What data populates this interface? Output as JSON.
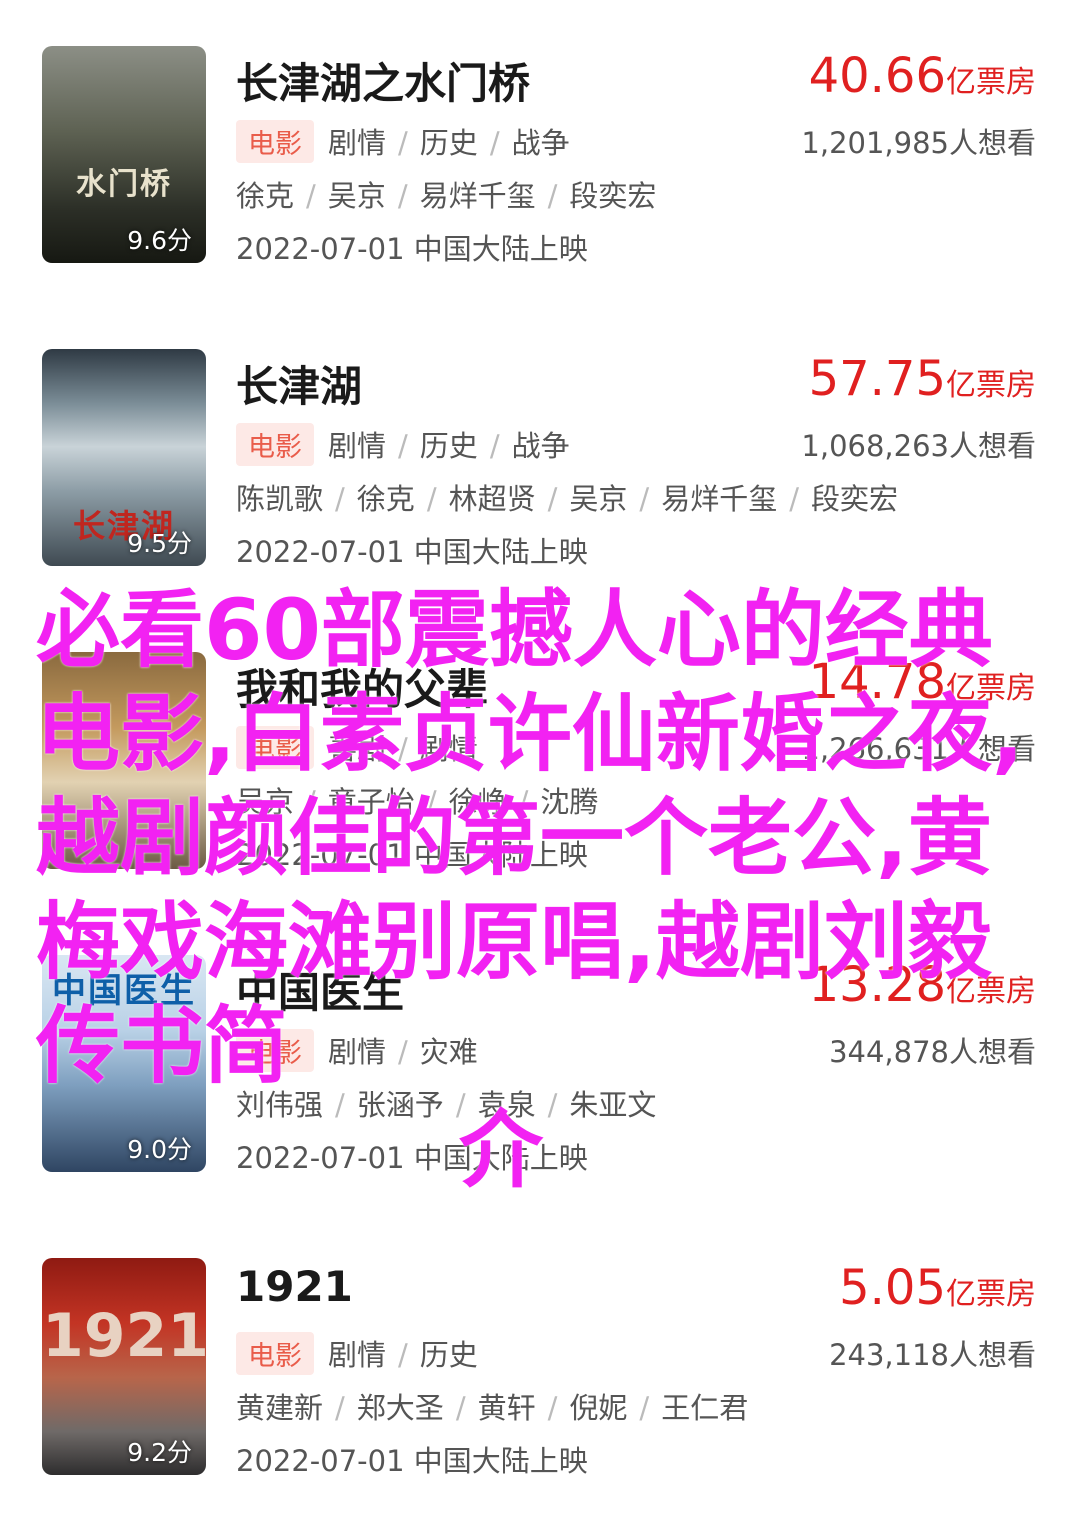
{
  "movies": [
    {
      "title": "长津湖之水门桥",
      "poster_text": "水门桥",
      "score": "9.6分",
      "box_office": "40.66",
      "box_unit": "亿票房",
      "badge": "电影",
      "genres": [
        "剧情",
        "历史",
        "战争"
      ],
      "want": "1,201,985人想看",
      "cast": [
        "徐克",
        "吴京",
        "易烊千玺",
        "段奕宏"
      ],
      "release": "2022-07-01 中国大陆上映"
    },
    {
      "title": "长津湖",
      "poster_text": "长津湖",
      "score": "9.5分",
      "box_office": "57.75",
      "box_unit": "亿票房",
      "badge": "电影",
      "genres": [
        "剧情",
        "历史",
        "战争"
      ],
      "want": "1,068,263人想看",
      "cast": [
        "陈凯歌",
        "徐克",
        "林超贤",
        "吴京",
        "易烊千玺",
        "段奕宏"
      ],
      "release": "2022-07-01 中国大陆上映"
    },
    {
      "title": "我和我的父辈",
      "poster_text": "",
      "score": "",
      "box_office": "14.78",
      "box_unit": "亿票房",
      "badge": "电影",
      "genres": [
        "喜剧",
        "剧情"
      ],
      "want": "1,266,631人想看",
      "cast": [
        "吴京",
        "章子怡",
        "徐峥",
        "沈腾"
      ],
      "release": "2022-07-01 中国大陆上映"
    },
    {
      "title": "中国医生",
      "poster_text": "中国医生",
      "score": "9.0分",
      "box_office": "13.28",
      "box_unit": "亿票房",
      "badge": "电影",
      "genres": [
        "剧情",
        "灾难"
      ],
      "want": "344,878人想看",
      "cast": [
        "刘伟强",
        "张涵予",
        "袁泉",
        "朱亚文"
      ],
      "release": "2022-07-01 中国大陆上映"
    },
    {
      "title": "1921",
      "poster_text": "1921",
      "score": "9.2分",
      "box_office": "5.05",
      "box_unit": "亿票房",
      "badge": "电影",
      "genres": [
        "剧情",
        "历史"
      ],
      "want": "243,118人想看",
      "cast": [
        "黄建新",
        "郑大圣",
        "黄轩",
        "倪妮",
        "王仁君"
      ],
      "release": "2022-07-01 中国大陆上映"
    }
  ],
  "overlay": {
    "text": "必看60部震撼人心的经典电影,白素贞许仙新婚之夜,越剧颜佳的第一个老公,黄梅戏海滩别原唱,越剧刘毅传书简",
    "tail": "介"
  },
  "colors": {
    "accent_red": "#e02020",
    "badge_text": "#e95c4a",
    "badge_bg": "#fde9e6",
    "overlay_text": "#f222f2"
  }
}
